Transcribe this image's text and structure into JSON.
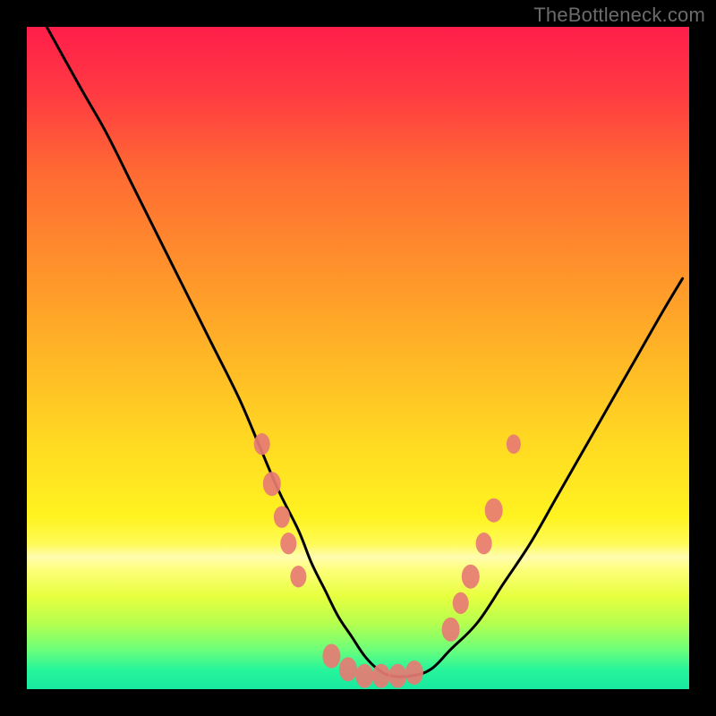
{
  "watermark": {
    "text": "TheBottleneck.com"
  },
  "gradient": {
    "stops": [
      {
        "offset": 0.0,
        "color": "#ff1e4a"
      },
      {
        "offset": 0.1,
        "color": "#ff3a42"
      },
      {
        "offset": 0.22,
        "color": "#ff6a33"
      },
      {
        "offset": 0.35,
        "color": "#ff8e2c"
      },
      {
        "offset": 0.5,
        "color": "#ffb726"
      },
      {
        "offset": 0.63,
        "color": "#ffda22"
      },
      {
        "offset": 0.74,
        "color": "#fff321"
      },
      {
        "offset": 0.78,
        "color": "#fffb55"
      },
      {
        "offset": 0.8,
        "color": "#fffcb0"
      },
      {
        "offset": 0.82,
        "color": "#fdff7a"
      },
      {
        "offset": 0.86,
        "color": "#e7ff3e"
      },
      {
        "offset": 0.9,
        "color": "#b6ff4e"
      },
      {
        "offset": 0.94,
        "color": "#6dff7a"
      },
      {
        "offset": 0.97,
        "color": "#28f59a"
      },
      {
        "offset": 1.0,
        "color": "#17e9a0"
      }
    ]
  },
  "chart_data": {
    "type": "line",
    "title": "",
    "xlabel": "",
    "ylabel": "",
    "xlim": [
      0,
      100
    ],
    "ylim": [
      0,
      100
    ],
    "series": [
      {
        "name": "bottleneck-curve",
        "x": [
          3,
          8,
          12,
          16,
          20,
          24,
          28,
          32,
          35,
          38,
          41,
          43,
          45,
          47,
          49,
          51,
          53,
          55,
          58,
          61,
          64,
          68,
          72,
          76,
          80,
          84,
          88,
          92,
          96,
          99
        ],
        "y": [
          100,
          91,
          84,
          76,
          68,
          60,
          52,
          44,
          37,
          30,
          24,
          19,
          15,
          11,
          8,
          5,
          3,
          2,
          2,
          3,
          6,
          10,
          16,
          22,
          29,
          36,
          43,
          50,
          57,
          62
        ]
      }
    ],
    "markers": {
      "name": "highlight-points",
      "color": "#e77b74",
      "points": [
        {
          "x": 35.5,
          "y": 37,
          "r": 9
        },
        {
          "x": 37.0,
          "y": 31,
          "r": 10
        },
        {
          "x": 38.5,
          "y": 26,
          "r": 9
        },
        {
          "x": 39.5,
          "y": 22,
          "r": 9
        },
        {
          "x": 41.0,
          "y": 17,
          "r": 9
        },
        {
          "x": 46.0,
          "y": 5,
          "r": 10
        },
        {
          "x": 48.5,
          "y": 3,
          "r": 10
        },
        {
          "x": 51.0,
          "y": 2,
          "r": 10
        },
        {
          "x": 53.5,
          "y": 2,
          "r": 10
        },
        {
          "x": 56.0,
          "y": 2,
          "r": 10
        },
        {
          "x": 58.5,
          "y": 2.5,
          "r": 10
        },
        {
          "x": 64.0,
          "y": 9,
          "r": 10
        },
        {
          "x": 65.5,
          "y": 13,
          "r": 9
        },
        {
          "x": 67.0,
          "y": 17,
          "r": 10
        },
        {
          "x": 69.0,
          "y": 22,
          "r": 9
        },
        {
          "x": 70.5,
          "y": 27,
          "r": 10
        },
        {
          "x": 73.5,
          "y": 37,
          "r": 8
        }
      ]
    }
  }
}
